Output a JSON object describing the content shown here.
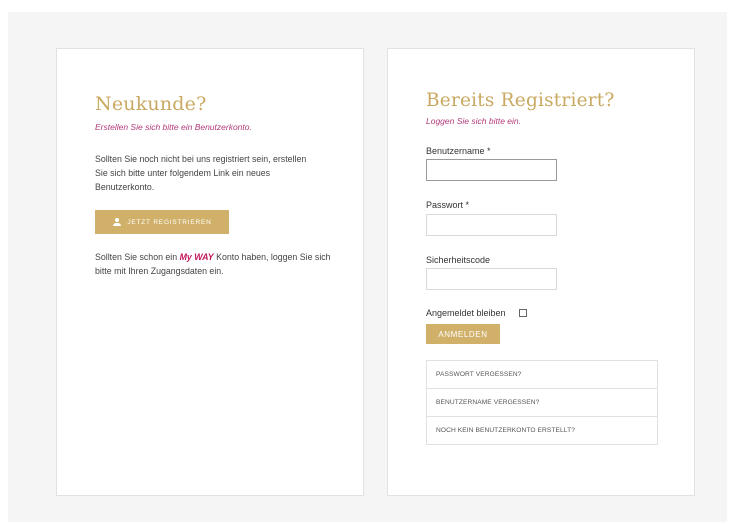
{
  "new_customer": {
    "title": "Neukunde?",
    "subtitle": "Erstellen Sie sich bitte ein Benutzerkonto.",
    "paragraph1": "Sollten Sie noch nicht bei uns registriert sein, erstellen Sie sich bitte unter folgendem Link ein neues Benutzerkonto.",
    "register_button": "JETZT REGISTRIEREN",
    "paragraph2_pre": "Sollten Sie schon ein ",
    "paragraph2_brand": "My WAY",
    "paragraph2_post": " Konto haben, loggen Sie sich bitte mit Ihren Zugangsdaten ein."
  },
  "login": {
    "title": "Bereits Registriert?",
    "subtitle": "Loggen Sie sich bitte ein.",
    "username_label": "Benutzername *",
    "username_value": "",
    "password_label": "Passwort *",
    "password_value": "",
    "security_label": "Sicherheitscode",
    "security_value": "",
    "remember_label": "Angemeldet bleiben",
    "login_button": "ANMELDEN",
    "links": [
      "PASSWORT VERGESSEN?",
      "BENUTZERNAME VERGESSEN?",
      "NOCH KEIN BENUTZERKONTO ERSTELLT?"
    ]
  },
  "colors": {
    "accent_gold": "#c9a962",
    "button_gold": "#d1b06a",
    "brand_magenta": "#c2185b",
    "subtitle_magenta": "#b23a7a"
  }
}
